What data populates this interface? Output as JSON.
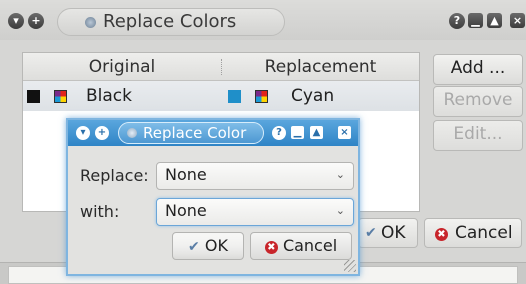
{
  "outer_window": {
    "title": "Replace Colors",
    "titlebar_left_glyphs": [
      "▾",
      "+"
    ],
    "titlebar_right_glyphs": [
      "?",
      "▁",
      "▲",
      "×"
    ],
    "table": {
      "columns": [
        "Original",
        "Replacement"
      ],
      "rows": [
        {
          "original": "Black",
          "original_color": "#111111",
          "replacement": "Cyan",
          "replacement_color": "#1f8fc9"
        }
      ]
    },
    "buttons": {
      "add": "Add ...",
      "remove": "Remove",
      "edit": "Edit...",
      "ok": "OK",
      "cancel": "Cancel"
    }
  },
  "dialog": {
    "title": "Replace Color",
    "titlebar_left_glyphs": [
      "▾",
      "+"
    ],
    "titlebar_right_glyphs": [
      "?",
      "▁",
      "▲",
      "×"
    ],
    "replace_label": "Replace:",
    "replace_value": "None",
    "with_label": "with:",
    "with_value": "None",
    "combo_arrow": "⌄",
    "ok_label": "OK",
    "cancel_label": "Cancel",
    "ok_icon": "✔",
    "cancel_icon": "✖"
  },
  "colors": {
    "dialog_accent": "#3a8fd0",
    "cancel_icon": "#c8252b"
  }
}
